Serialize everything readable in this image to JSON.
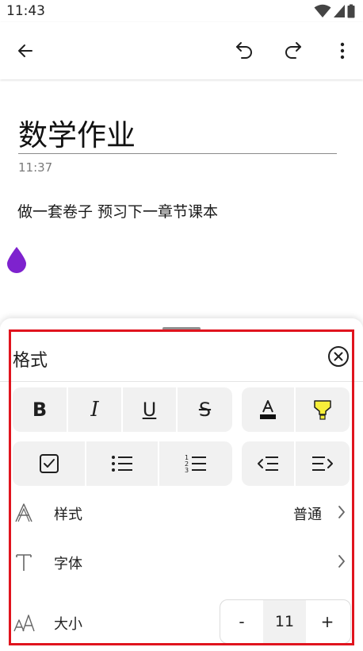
{
  "status_bar": {
    "time": "11:43"
  },
  "note": {
    "title": "数学作业",
    "time": "11:37",
    "body": "做一套卷子  预习下一章节课本"
  },
  "format_panel": {
    "title": "格式",
    "rows": {
      "style": {
        "label": "样式",
        "value": "普通"
      },
      "font": {
        "label": "字体"
      },
      "size": {
        "label": "大小",
        "decrement": "-",
        "value": "11",
        "increment": "+"
      }
    }
  },
  "colors": {
    "ink_drop": "#7e22ce",
    "highlighter": "#f7ef3a",
    "selection_outline": "#e0141e",
    "button_bg": "#f1f1f1"
  },
  "icons": {
    "back": "arrow-left-icon",
    "undo": "undo-icon",
    "redo": "redo-icon",
    "more": "more-vertical-icon",
    "close": "close-circle-icon"
  }
}
